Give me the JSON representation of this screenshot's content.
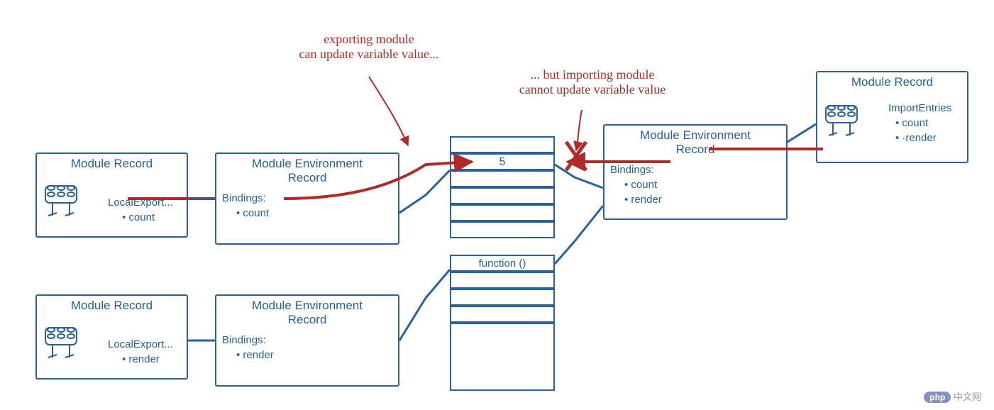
{
  "annotations": {
    "exporting": "exporting module\ncan update variable value...",
    "importing": "... but importing module\ncannot update variable value"
  },
  "modRecordTopLeft": {
    "title": "Module Record",
    "field": "LocalExport...",
    "items": [
      "count"
    ]
  },
  "envRecordTopLeft": {
    "title": "Module Environment\nRecord",
    "field": "Bindings:",
    "items": [
      "count"
    ]
  },
  "modRecordBottomLeft": {
    "title": "Module Record",
    "field": "LocalExport...",
    "items": [
      "render"
    ]
  },
  "envRecordBottomLeft": {
    "title": "Module Environment\nRecord",
    "field": "Bindings:",
    "items": [
      "render"
    ]
  },
  "envRecordRight": {
    "title": "Module Environment\nRecord",
    "field": "Bindings:",
    "items": [
      "count",
      "render"
    ]
  },
  "modRecordRight": {
    "title": "Module Record",
    "field": "ImportEntries",
    "items": [
      "count",
      "·render"
    ]
  },
  "memory": {
    "cells": [
      "",
      "5",
      "",
      "",
      "",
      "",
      "function ()",
      "",
      "",
      "",
      ""
    ]
  },
  "watermark": "中文网",
  "watermarkBrand": "php"
}
